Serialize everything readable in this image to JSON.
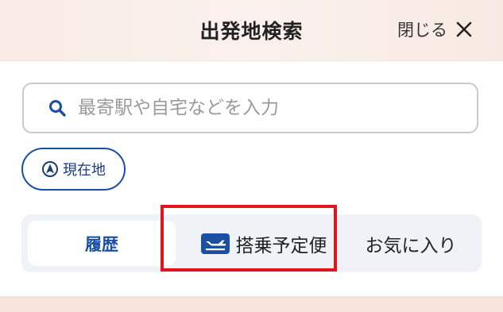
{
  "header": {
    "title": "出発地検索",
    "close_label": "閉じる",
    "close_icon": "close-icon"
  },
  "search": {
    "placeholder": "最寄駅や自宅などを入力",
    "value": "",
    "icon": "search-icon"
  },
  "location_button": {
    "label": "現在地",
    "icon": "location-arrow-icon"
  },
  "tabs": [
    {
      "label": "履歴",
      "selected": true
    },
    {
      "label": "搭乗予定便",
      "icon": "plane-icon",
      "selected": false
    },
    {
      "label": "お気に入り",
      "selected": false
    }
  ],
  "colors": {
    "accent": "#1a4fa3",
    "highlight": "#e0151d",
    "header_bg": "#f9ece6",
    "tabs_bg": "#eff2f7"
  }
}
